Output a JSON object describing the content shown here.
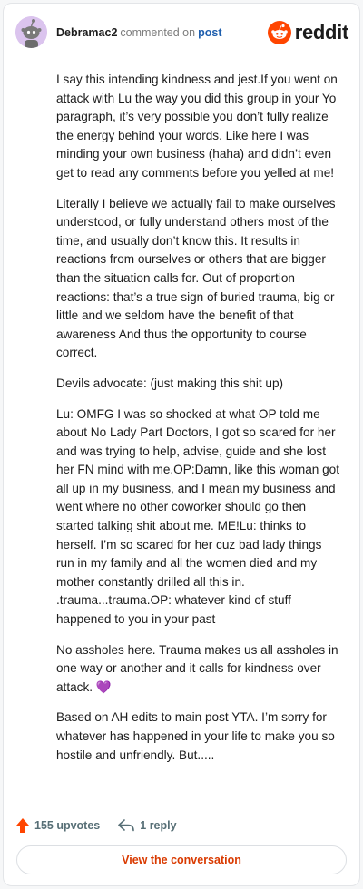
{
  "header": {
    "username": "Debramac2",
    "action_text": "commented on",
    "target_link": "post",
    "brand": "reddit"
  },
  "comment": {
    "paragraphs": [
      "I say this intending kindness and jest.If you went on attack with Lu the way you did this group in your Yo paragraph, it’s very possible you don’t fully realize the energy behind your words. Like here I was minding your own business (haha) and didn’t even get to read any comments before you yelled at me!",
      "Literally I believe we actually fail to make ourselves understood, or fully understand others most of the time, and usually don’t know this. It results in reactions from ourselves or others that are bigger than the situation calls for. Out of proportion reactions: that’s a true sign of buried trauma, big or little and we seldom have the benefit of that awareness And thus the opportunity to course correct.",
      "Devils advocate: (just making this shit up)",
      "Lu: OMFG I was so shocked at what OP told me about No Lady Part Doctors, I got so scared for her and was trying to help, advise, guide and she lost her FN mind with me.OP:Damn, like this woman got all up in my business, and I mean my business and went where no other coworker should go then started talking shit about me. ME!Lu: thinks to herself. I’m so scared for her cuz bad lady things run in my family and all the women died and my mother constantly drilled all this in. .trauma...trauma.OP: whatever kind of stuff happened to you in your past",
      "No assholes here. Trauma makes us all assholes in one way or another and it calls for kindness over attack. 💜",
      "Based on AH edits to main post YTA. I’m sorry for whatever has happened in your life to make you so hostile and unfriendly. But....."
    ]
  },
  "footer": {
    "upvotes": "155 upvotes",
    "replies": "1 reply",
    "view_button": "View the conversation"
  },
  "colors": {
    "accent": "#d93a00",
    "link": "#1f5fae",
    "upvote": "#ff4500",
    "avatar_bg": "#dbc4ee"
  },
  "icons": {
    "avatar": "snoo-avatar-icon",
    "brand_logo": "reddit-logo-icon",
    "upvote": "upvote-arrow-icon",
    "reply": "reply-arrow-icon"
  }
}
